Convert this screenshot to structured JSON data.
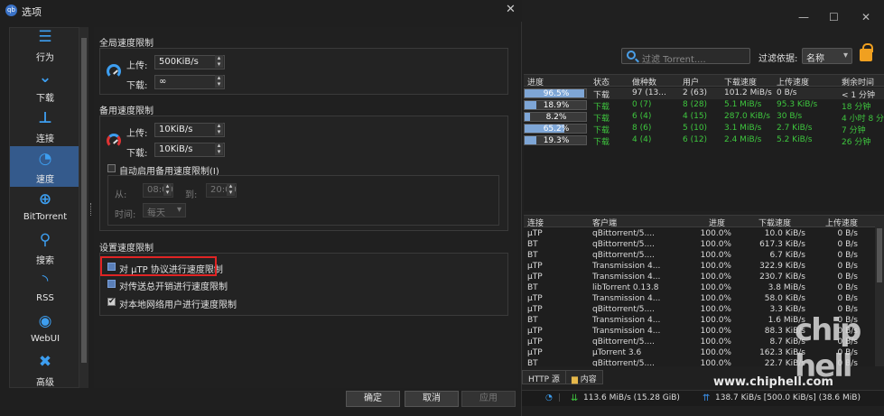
{
  "dialog": {
    "title": "选项",
    "sidebar": [
      {
        "label": "行为",
        "icon": "sliders-icon",
        "glyph": "☰"
      },
      {
        "label": "下载",
        "icon": "download-chevron-icon",
        "glyph": "⌄"
      },
      {
        "label": "连接",
        "icon": "network-icon",
        "glyph": "⊥"
      },
      {
        "label": "速度",
        "icon": "speedometer-icon",
        "glyph": "◔"
      },
      {
        "label": "BitTorrent",
        "icon": "globe-icon",
        "glyph": "⊕"
      },
      {
        "label": "搜索",
        "icon": "search-icon",
        "glyph": "⚲"
      },
      {
        "label": "RSS",
        "icon": "rss-icon",
        "glyph": "◝"
      },
      {
        "label": "WebUI",
        "icon": "webui-icon",
        "glyph": "◉"
      },
      {
        "label": "高级",
        "icon": "wrench-icon",
        "glyph": "✖"
      }
    ],
    "global": {
      "title": "全局速度限制",
      "upload_label": "上传:",
      "upload_value": "500KiB/s",
      "download_label": "下载:",
      "download_value": "∞"
    },
    "alt": {
      "title": "备用速度限制",
      "upload_label": "上传:",
      "upload_value": "10KiB/s",
      "download_label": "下载:",
      "download_value": "10KiB/s",
      "schedule_label": "自动启用备用速度限制(I)",
      "from_label": "从:",
      "from_value": "08:00",
      "to_label": "到:",
      "to_value": "20:00",
      "time_label": "时间:",
      "time_value": "每天"
    },
    "settings": {
      "title": "设置速度限制",
      "utp": "对 µTP 协议进行速度限制",
      "overhead": "对传送总开销进行速度限制",
      "lan": "对本地网络用户进行速度限制"
    },
    "buttons": {
      "ok": "确定",
      "cancel": "取消",
      "apply": "应用"
    }
  },
  "main": {
    "filter_placeholder": "过滤 Torrent....",
    "filter_by_label": "过滤依据:",
    "filter_by_value": "名称",
    "torrent_headers": [
      "进度",
      "状态",
      "做种数",
      "用户",
      "下载速度",
      "上传速度",
      "剩余时间"
    ],
    "torrents": [
      {
        "progress": 96.5,
        "progress_text": "96.5%",
        "status": "下载",
        "seeds": "97 (13...",
        "peers": "2 (63)",
        "dl": "101.2 MiB/s",
        "ul": "0 B/s",
        "eta": "< 1 分钟",
        "highlight": true
      },
      {
        "progress": 18.9,
        "progress_text": "18.9%",
        "status": "下载",
        "seeds": "0 (7)",
        "peers": "8 (28)",
        "dl": "5.1 MiB/s",
        "ul": "95.3 KiB/s",
        "eta": "18 分钟",
        "highlight": false
      },
      {
        "progress": 8.2,
        "progress_text": "8.2%",
        "status": "下载",
        "seeds": "6 (4)",
        "peers": "4 (15)",
        "dl": "287.0 KiB/s",
        "ul": "30 B/s",
        "eta": "4 小时 8 分钟",
        "highlight": false
      },
      {
        "progress": 65.2,
        "progress_text": "65.2%",
        "status": "下载",
        "seeds": "8 (6)",
        "peers": "5 (10)",
        "dl": "3.1 MiB/s",
        "ul": "2.7 KiB/s",
        "eta": "7 分钟",
        "highlight": false
      },
      {
        "progress": 19.3,
        "progress_text": "19.3%",
        "status": "下载",
        "seeds": "4 (4)",
        "peers": "6 (12)",
        "dl": "2.4 MiB/s",
        "ul": "5.2 KiB/s",
        "eta": "26 分钟",
        "highlight": false
      }
    ],
    "peer_headers": [
      "连接",
      "客户端",
      "进度",
      "下载速度",
      "上传速度"
    ],
    "peers": [
      [
        "µTP",
        "qBittorrent/5....",
        "100.0%",
        "10.0 KiB/s",
        "0 B/s"
      ],
      [
        "BT",
        "qBittorrent/5....",
        "100.0%",
        "617.3 KiB/s",
        "0 B/s"
      ],
      [
        "BT",
        "qBittorrent/5....",
        "100.0%",
        "6.7 KiB/s",
        "0 B/s"
      ],
      [
        "µTP",
        "Transmission 4...",
        "100.0%",
        "322.9 KiB/s",
        "0 B/s"
      ],
      [
        "µTP",
        "Transmission 4...",
        "100.0%",
        "230.7 KiB/s",
        "0 B/s"
      ],
      [
        "BT",
        "libTorrent 0.13.8",
        "100.0%",
        "3.8 MiB/s",
        "0 B/s"
      ],
      [
        "µTP",
        "Transmission 4...",
        "100.0%",
        "58.0 KiB/s",
        "0 B/s"
      ],
      [
        "µTP",
        "qBittorrent/5....",
        "100.0%",
        "3.3 KiB/s",
        "0 B/s"
      ],
      [
        "BT",
        "Transmission 4...",
        "100.0%",
        "1.6 MiB/s",
        "0 B/s"
      ],
      [
        "µTP",
        "Transmission 4...",
        "100.0%",
        "88.3 KiB/s",
        "0 B/s"
      ],
      [
        "µTP",
        "qBittorrent/5....",
        "100.0%",
        "8.7 KiB/s",
        "0 B/s"
      ],
      [
        "µTP",
        "µTorrent 3.6",
        "100.0%",
        "162.3 KiB/s",
        "0 B/s"
      ],
      [
        "BT",
        "qBittorrent/5....",
        "100.0%",
        "22.7 KiB/s",
        "0 B/s"
      ]
    ],
    "tabs": {
      "http": "HTTP 源",
      "content": "内容"
    },
    "status": {
      "download": "113.6 MiB/s (15.28 GiB)",
      "upload": "138.7 KiB/s [500.0 KiB/s] (38.6 MiB)"
    },
    "watermark_text": "chip\nhell",
    "watermark_url": "www.chiphell.com"
  }
}
